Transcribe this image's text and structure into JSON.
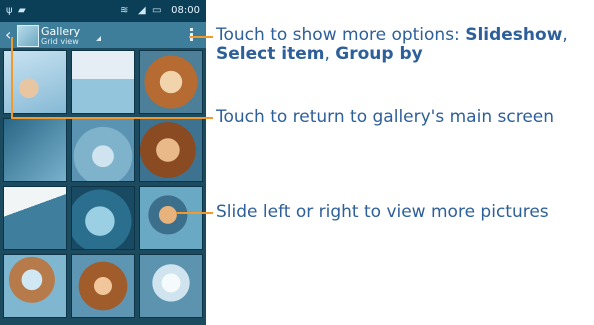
{
  "status_bar": {
    "time": "08:00",
    "icons": [
      "usb-icon",
      "android-icon",
      "wifi-icon",
      "signal-icon",
      "battery-icon"
    ]
  },
  "action_bar": {
    "title": "Gallery",
    "subtitle": "Grid view",
    "back_icon": "chevron-left-icon",
    "menu_icon": "overflow-menu-icon"
  },
  "grid": {
    "tiles": [
      {
        "name": "photo-tile-1"
      },
      {
        "name": "photo-tile-2"
      },
      {
        "name": "photo-tile-3"
      },
      {
        "name": "photo-tile-4"
      },
      {
        "name": "photo-tile-5"
      },
      {
        "name": "photo-tile-6"
      },
      {
        "name": "photo-tile-7"
      },
      {
        "name": "photo-tile-8"
      },
      {
        "name": "photo-tile-9"
      },
      {
        "name": "photo-tile-10"
      },
      {
        "name": "photo-tile-11"
      },
      {
        "name": "photo-tile-12"
      }
    ]
  },
  "annotations": {
    "menu": {
      "prefix": "Touch to show more options: ",
      "opt1": "Slideshow",
      "sep1": ",",
      "opt2": "Select item",
      "sep2": ", ",
      "opt3": "Group by"
    },
    "back": "Touch to return to gallery's main screen",
    "swipe": "Slide left or right to view more pictures"
  },
  "colors": {
    "annotation_text": "#2d5f9a",
    "callout_line": "#f09a2b",
    "action_bar": "#3e7e9a",
    "status_bar": "#0b3f57"
  }
}
